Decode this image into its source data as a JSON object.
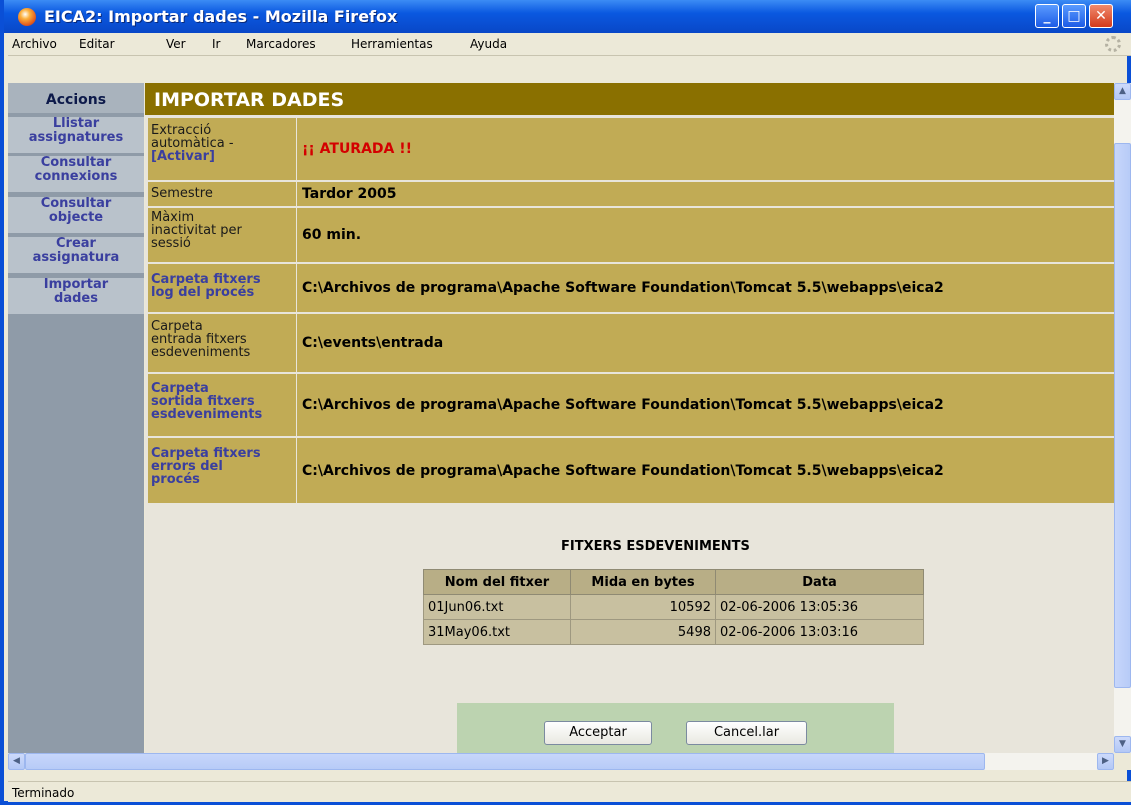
{
  "window": {
    "title": "EICA2: Importar dades - Mozilla Firefox"
  },
  "menubar": [
    "Archivo",
    "Editar",
    "Ver",
    "Ir",
    "Marcadores",
    "Herramientas",
    "Ayuda"
  ],
  "sidebar": {
    "title": "Accions",
    "items": [
      {
        "line1": "Llistar",
        "line2": "assignatures"
      },
      {
        "line1": "Consultar",
        "line2": "connexions"
      },
      {
        "line1": "Consultar",
        "line2": "objecte"
      },
      {
        "line1": "Crear",
        "line2": "assignatura"
      },
      {
        "line1": "Importar",
        "line2": "dades"
      }
    ]
  },
  "page": {
    "title": "IMPORTAR DADES"
  },
  "rows": [
    {
      "label_lines": [
        "Extracció",
        "automàtica -"
      ],
      "label_link": "[Activar]",
      "value": "¡¡ ATURADA !!"
    },
    {
      "label_lines": [
        "Semestre"
      ],
      "value": "Tardor 2005"
    },
    {
      "label_lines": [
        "Màxim",
        "inactivitat per",
        "sessió"
      ],
      "value": "60 min."
    },
    {
      "label_lines": [
        "Carpeta fitxers",
        "log del procés"
      ],
      "value": "C:\\Archivos de programa\\Apache Software Foundation\\Tomcat 5.5\\webapps\\eica2"
    },
    {
      "label_lines": [
        "Carpeta",
        "entrada fitxers",
        "esdeveniments"
      ],
      "value": "C:\\events\\entrada"
    },
    {
      "label_lines": [
        "Carpeta",
        "sortida fitxers",
        "esdeveniments"
      ],
      "value": "C:\\Archivos de programa\\Apache Software Foundation\\Tomcat 5.5\\webapps\\eica2"
    },
    {
      "label_lines": [
        "Carpeta fitxers",
        "errors del",
        "procés"
      ],
      "value": "C:\\Archivos de programa\\Apache Software Foundation\\Tomcat 5.5\\webapps\\eica2"
    }
  ],
  "files": {
    "title": "FITXERS ESDEVENIMENTS",
    "headers": [
      "Nom del fitxer",
      "Mida en bytes",
      "Data"
    ],
    "rows": [
      [
        "01Jun06.txt",
        "10592",
        "02-06-2006 13:05:36"
      ],
      [
        "31May06.txt",
        "5498",
        "02-06-2006 13:03:16"
      ]
    ]
  },
  "buttons": {
    "accept": "Acceptar",
    "cancel": "Cancel.lar"
  },
  "status": "Terminado",
  "colors": {
    "header_bg": "#8a7000",
    "row_bg": "#c1ab55",
    "alert": "#d40000",
    "link": "#3a3f9f"
  },
  "icons": [
    "firefox-icon",
    "minimize-icon",
    "maximize-icon",
    "close-icon",
    "throbber-icon",
    "scroll-up-icon",
    "scroll-down-icon",
    "scroll-left-icon",
    "scroll-right-icon"
  ]
}
